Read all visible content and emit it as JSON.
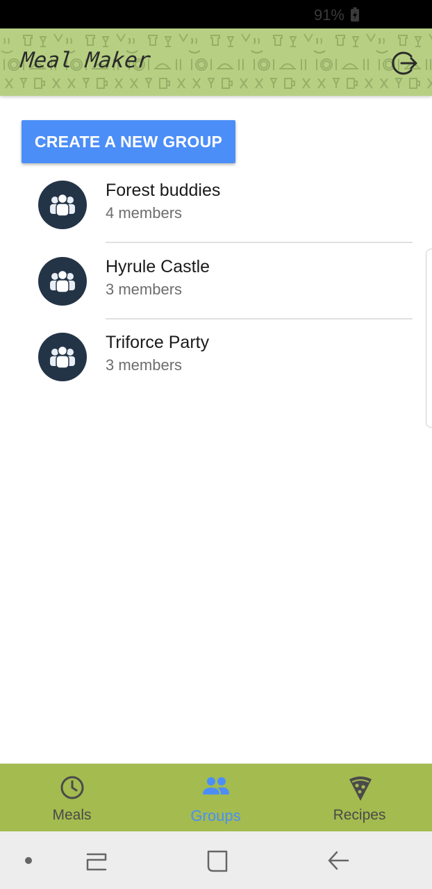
{
  "status_bar": {
    "battery_text": "91%",
    "battery_icon": "battery-charging-icon"
  },
  "app_bar": {
    "title": "Meal Maker",
    "action_icon": "logout-icon",
    "background_color": "#b7cf82"
  },
  "main": {
    "create_button_label": "CREATE A NEW GROUP",
    "groups": [
      {
        "name": "Forest buddies",
        "members": "4 members",
        "icon": "group-icon"
      },
      {
        "name": "Hyrule Castle",
        "members": "3 members",
        "icon": "group-icon"
      },
      {
        "name": "Triforce Party",
        "members": "3 members",
        "icon": "group-icon"
      }
    ]
  },
  "bottom_nav": {
    "active": "Groups",
    "active_color": "#4c8ef7",
    "background_color": "#a3bb4f",
    "tabs": [
      {
        "label": "Meals",
        "icon": "clock-icon"
      },
      {
        "label": "Groups",
        "icon": "people-icon"
      },
      {
        "label": "Recipes",
        "icon": "pizza-icon"
      }
    ]
  },
  "system_nav": {
    "buttons": [
      "dot-icon",
      "recent-apps-icon",
      "home-icon",
      "back-icon"
    ]
  }
}
